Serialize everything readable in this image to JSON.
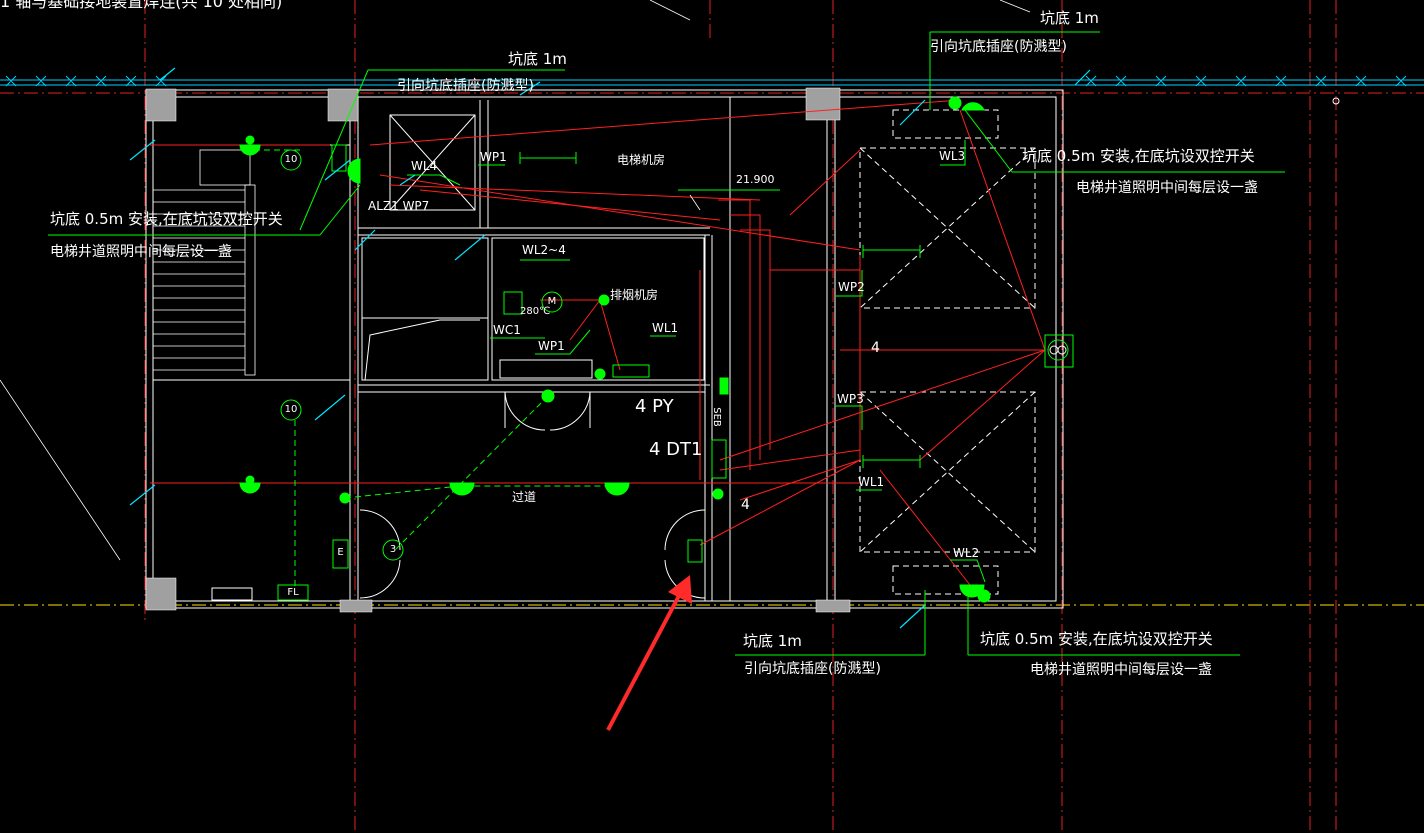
{
  "header_fragment": "1 轴与基础接地装置焊连(共            10  处相同)",
  "pit_1m_top_mid": "坑底 1m",
  "socket_top_mid": "引向坑底插座(防溅型)",
  "pit_1m_top_right": "坑底 1m",
  "socket_top_right": "引向坑底插座(防溅型)",
  "pit_05_left_line1": "坑底 0.5m  安装,在底坑设双控开关",
  "pit_05_left_line2": "电梯井道照明中间每层设一盏",
  "pit_05_right_top_line1": "坑底 0.5m  安装,在底坑设双控开关",
  "pit_05_right_top_line2": "电梯井道照明中间每层设一盏",
  "pit_1m_bottom": "坑底 1m",
  "socket_bottom": "引向坑底插座(防溅型)",
  "pit_05_right_bottom_line1": "坑底 0.5m  安装,在底坑设双控开关",
  "pit_05_right_bottom_line2": "电梯井道照明中间每层设一盏",
  "room_elevator_machine": "电梯机房",
  "room_smoke_exhaust": "排烟机房",
  "room_corridor": "过道",
  "elevation_value": "21.900",
  "tag_wp1_top": "WP1",
  "tag_wl4": "WL4",
  "tag_alz1_wp7": "ALZ1 WP7",
  "tag_wl2_4": "WL2~4",
  "tag_wc1": "WC1",
  "tag_wp1_mid": "WP1",
  "tag_wl1_mid": "WL1",
  "tag_temp": "280℃",
  "tag_4py": "4 PY",
  "tag_4dt1": "4 DT1",
  "tag_seb": "SEB",
  "tag_wl3": "WL3",
  "tag_wp2": "WP2",
  "tag_wp3": "WP3",
  "tag_wl1_right": "WL1",
  "tag_wl2_bottom": "WL2",
  "tag_4_shaft": "4",
  "tag_4_small": "4",
  "circle_10_top": "10",
  "circle_10_bottom": "10",
  "circle_3": "3",
  "box_e": "E",
  "box_fl": "FL",
  "motor_m": "M",
  "colors": {
    "background": "#000000",
    "wall": "#ffffff",
    "axis": "#ff2020",
    "wire": "#ff2020",
    "fixture": "#00ff00",
    "leader": "#00ff00",
    "grid_cyan": "#00e5ff",
    "column": "#a0a0a0",
    "arrow": "#ff2a2a"
  }
}
